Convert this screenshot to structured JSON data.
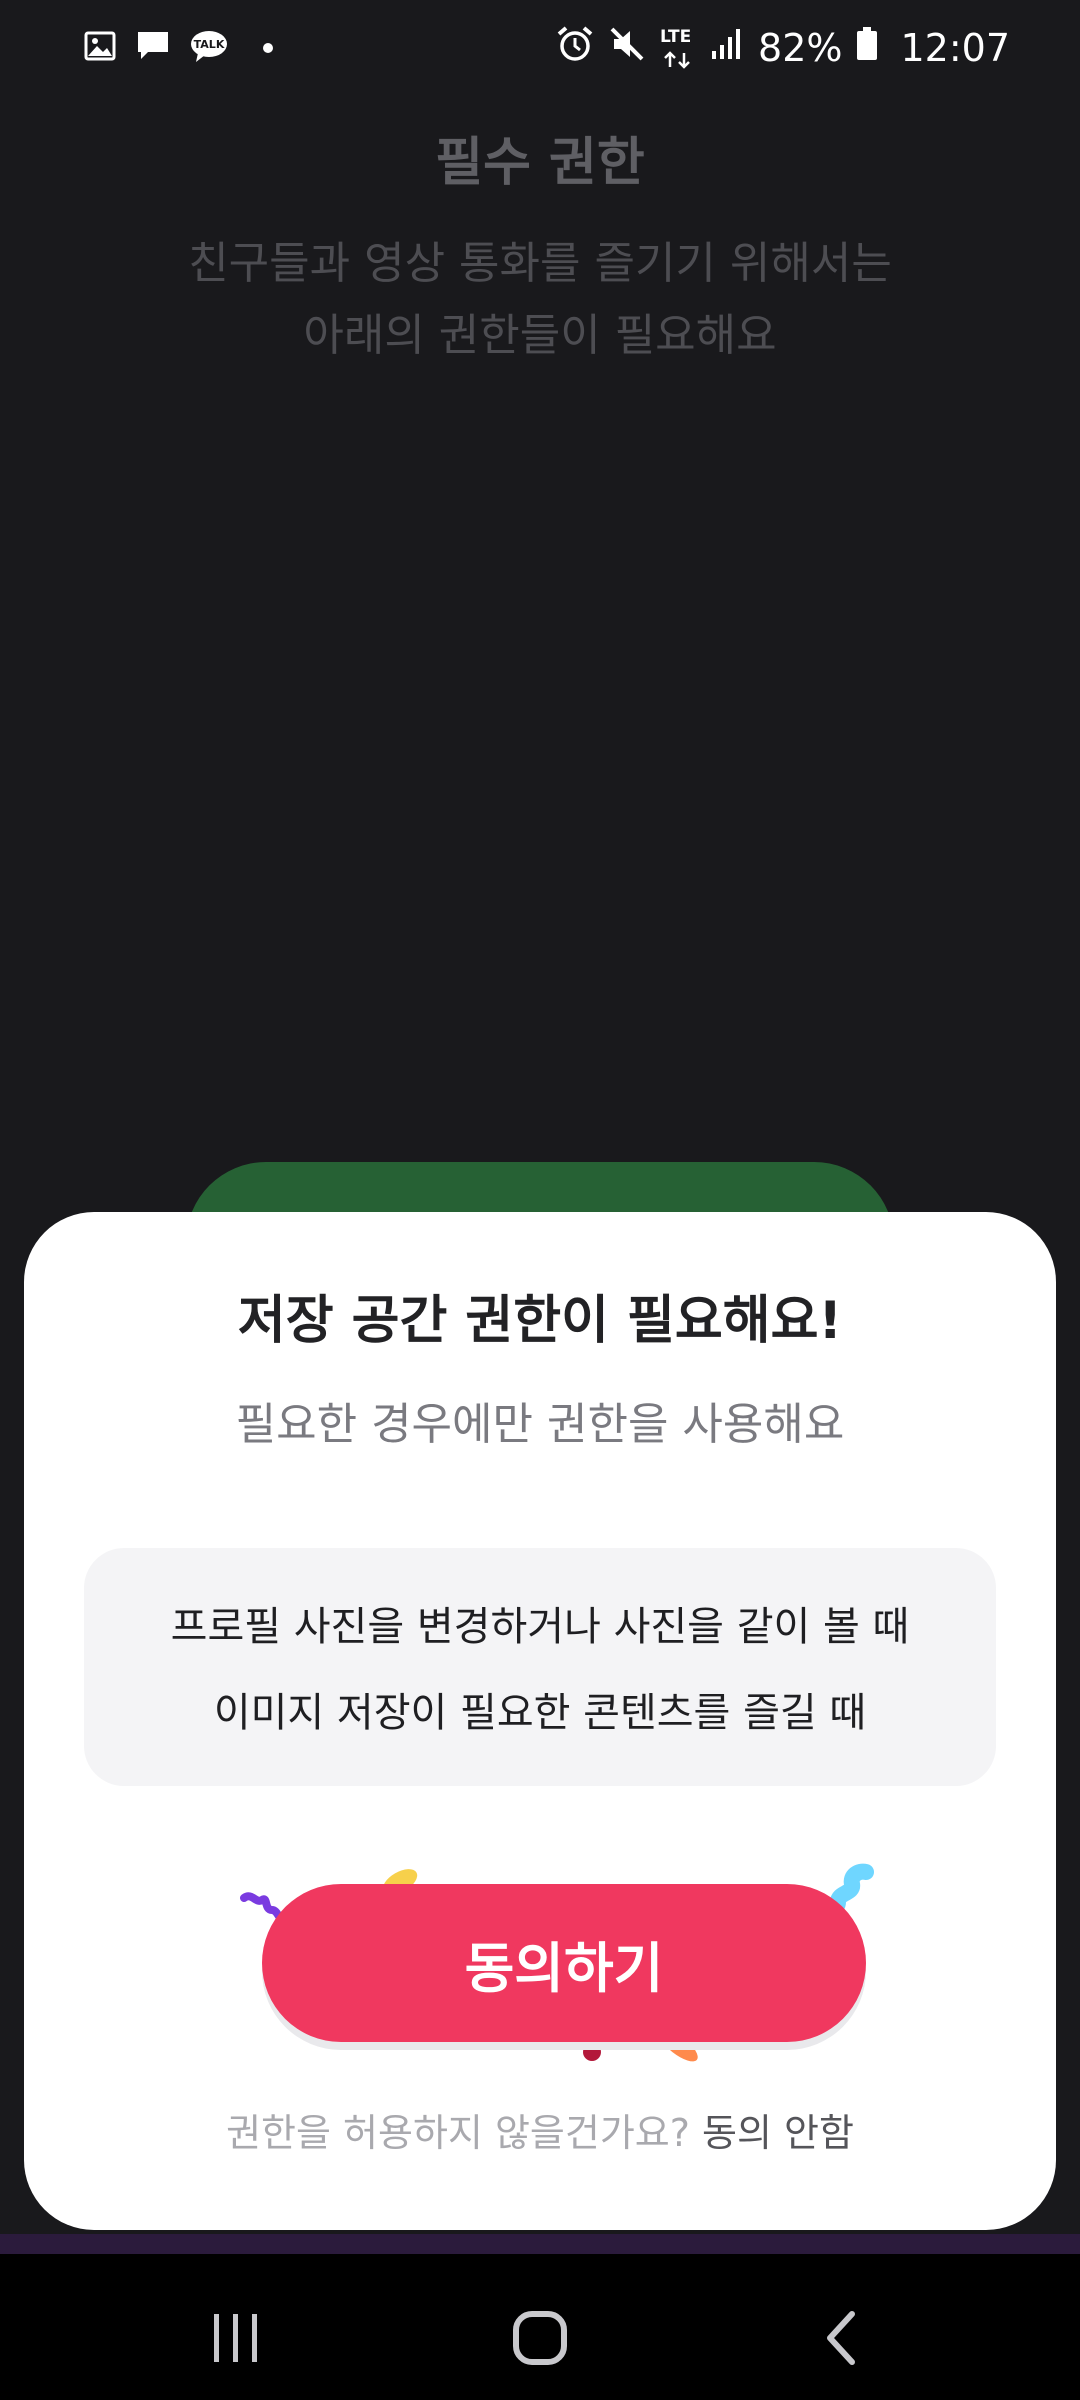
{
  "status_bar": {
    "battery": "82%",
    "time": "12:07",
    "network": "LTE",
    "icons": [
      "gallery-icon",
      "message-icon",
      "kakaotalk-icon",
      "dot-icon",
      "alarm-icon",
      "mute-icon",
      "lte-icon",
      "signal-icon",
      "battery-icon"
    ],
    "talk_label": "TALK"
  },
  "background": {
    "title": "필수 권한",
    "subtitle_line1": "친구들과 영상 통화를 즐기기 위해서는",
    "subtitle_line2": "아래의 권한들이 필요해요"
  },
  "sheet": {
    "title": "저장 공간 권한이 필요해요!",
    "subtitle": "필요한 경우에만 권한을 사용해요",
    "info_lines": [
      "프로필 사진을 변경하거나 사진을 같이 볼 때",
      "이미지 저장이 필요한 콘텐츠를 즐길 때"
    ],
    "agree_label": "동의하기",
    "decline_prompt": "권한을 허용하지 않을건가요?",
    "decline_label": "동의 안함"
  },
  "nav_bar": {
    "icons": [
      "recents-icon",
      "home-icon",
      "back-icon"
    ]
  },
  "colors": {
    "accent": "#f0385f",
    "background": "#19191c",
    "sheet": "#ffffff",
    "green_button": "#266134"
  }
}
